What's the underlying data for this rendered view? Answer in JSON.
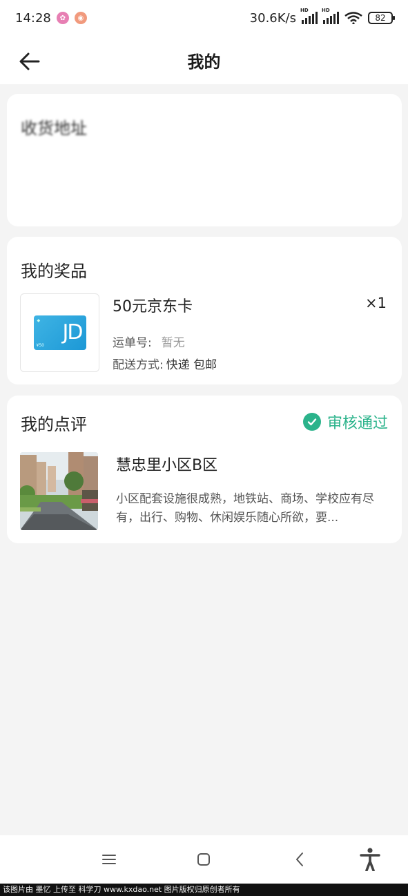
{
  "status_bar": {
    "time": "14:28",
    "network_speed": "30.6K/s",
    "signal_label_1": "HD",
    "signal_label_2": "HD",
    "battery": "82"
  },
  "header": {
    "title": "我的",
    "back_icon": "arrow-left-icon"
  },
  "address": {
    "title": "收货地址"
  },
  "prize": {
    "title": "我的奖品",
    "item_name": "50元京东卡",
    "quantity": "×1",
    "card_logo_text": "JD",
    "card_value_text": "¥50",
    "tracking_label": "运单号:",
    "tracking_value": "暂无",
    "delivery_label": "配送方式:",
    "delivery_value": "快递 包邮"
  },
  "review": {
    "title": "我的点评",
    "status": "审核通过",
    "status_color": "#2bb38b",
    "place_name": "慧忠里小区B区",
    "content": "小区配套设施很成熟，地铁站、商场、学校应有尽有，出行、购物、休闲娱乐随心所欲，要..."
  },
  "nav_bar": {
    "menu_icon": "menu-icon",
    "home_icon": "home-square-icon",
    "back_icon": "chevron-left-icon",
    "accessibility_icon": "accessibility-icon"
  },
  "watermark": "该图片由 墨忆 上传至 科学刀 www.kxdao.net 图片版权归原创者所有"
}
